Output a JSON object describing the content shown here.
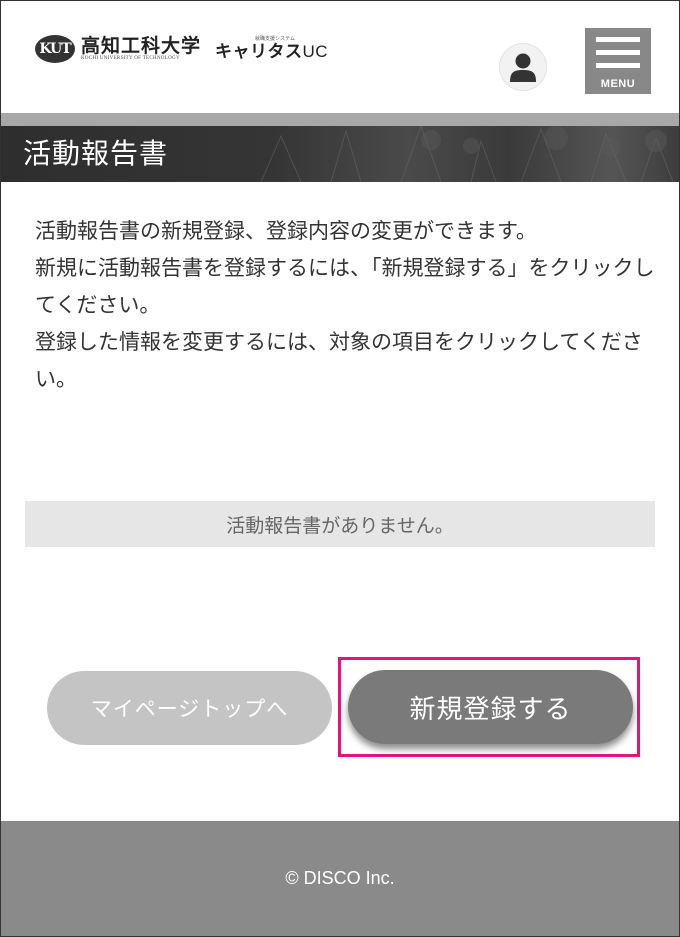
{
  "header": {
    "university_emblem": "KUT",
    "university_name": "高知工科大学",
    "university_name_en": "KOCHI UNIVERSITY OF TECHNOLOGY",
    "career_system_sub": "就職支援システム",
    "career_system_name": "キャリタス",
    "career_system_suffix": "UC",
    "avatar_icon": "user-icon",
    "menu_label": "MENU"
  },
  "page": {
    "title": "活動報告書",
    "description": [
      "活動報告書の新規登録、登録内容の変更ができます。",
      "新規に活動報告書を登録するには、「新規登録する」をクリックしてください。",
      "登録した情報を変更するには、対象の項目をクリックしてください。"
    ],
    "empty_message": "活動報告書がありません。"
  },
  "buttons": {
    "mypage_top": "マイページトップへ",
    "new_register": "新規登録する"
  },
  "footer": {
    "copyright": "© DISCO Inc."
  },
  "colors": {
    "highlight": "#e3147f",
    "primary_button": "#7a7a7a",
    "secondary_button": "#c4c4c4",
    "footer": "#8a8a8a"
  }
}
